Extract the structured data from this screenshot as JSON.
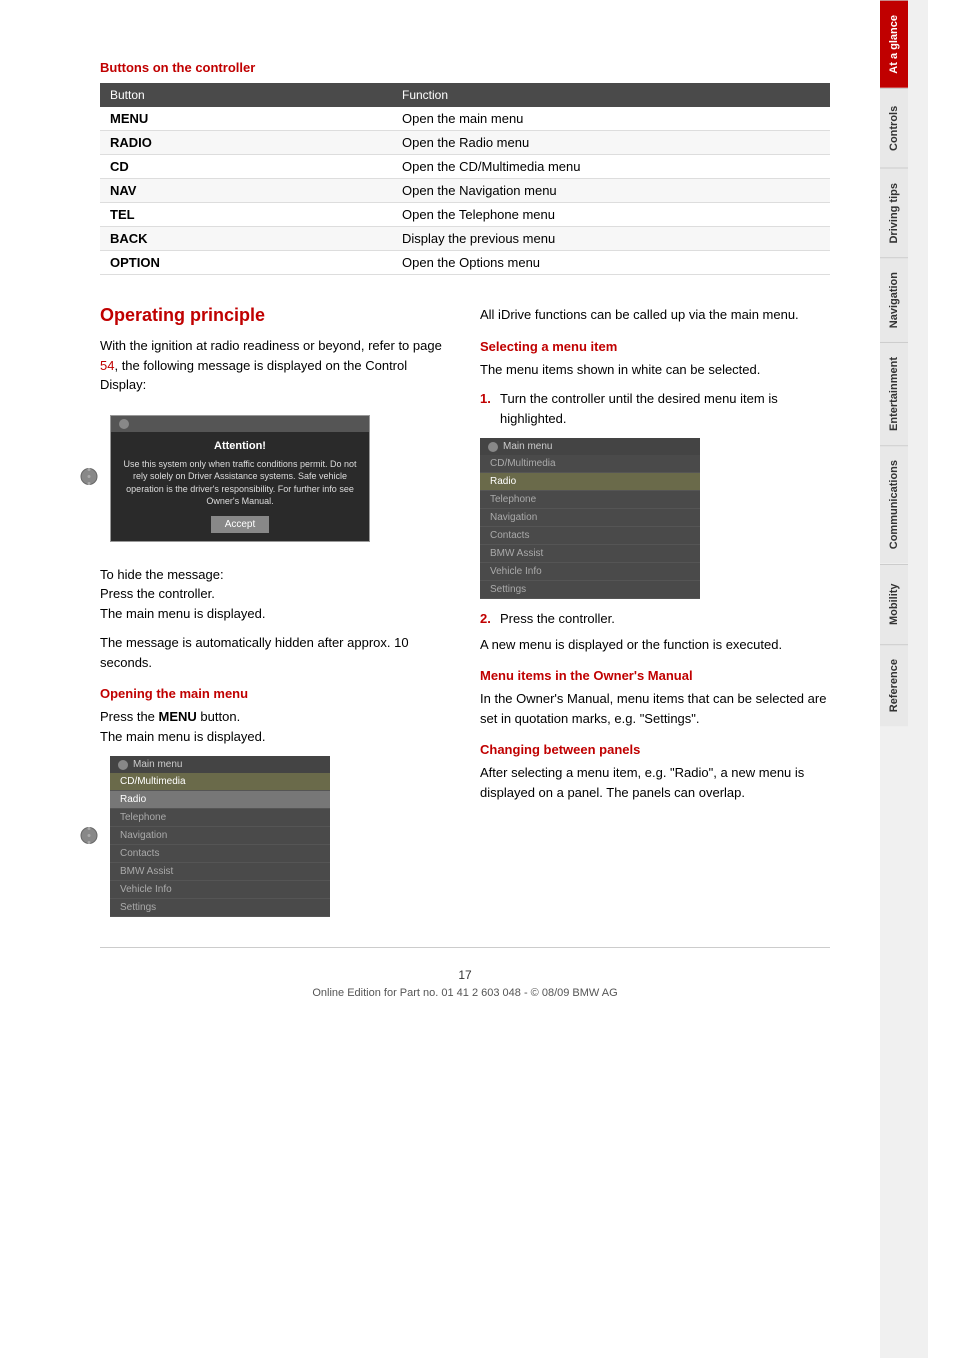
{
  "page": {
    "number": "17",
    "footer_text": "Online Edition for Part no. 01 41 2 603 048 - © 08/09 BMW AG"
  },
  "sidebar": {
    "tabs": [
      {
        "id": "at-a-glance",
        "label": "At a glance",
        "active": true
      },
      {
        "id": "controls",
        "label": "Controls",
        "active": false
      },
      {
        "id": "driving-tips",
        "label": "Driving tips",
        "active": false
      },
      {
        "id": "navigation",
        "label": "Navigation",
        "active": false
      },
      {
        "id": "entertainment",
        "label": "Entertainment",
        "active": false
      },
      {
        "id": "communications",
        "label": "Communications",
        "active": false
      },
      {
        "id": "mobility",
        "label": "Mobility",
        "active": false
      },
      {
        "id": "reference",
        "label": "Reference",
        "active": false
      }
    ]
  },
  "buttons_table": {
    "section_heading": "Buttons on the controller",
    "col_button": "Button",
    "col_function": "Function",
    "rows": [
      {
        "button": "MENU",
        "function": "Open the main menu"
      },
      {
        "button": "RADIO",
        "function": "Open the Radio menu"
      },
      {
        "button": "CD",
        "function": "Open the CD/Multimedia menu"
      },
      {
        "button": "NAV",
        "function": "Open the Navigation menu"
      },
      {
        "button": "TEL",
        "function": "Open the Telephone menu"
      },
      {
        "button": "BACK",
        "function": "Display the previous menu"
      },
      {
        "button": "OPTION",
        "function": "Open the Options menu"
      }
    ]
  },
  "operating_principle": {
    "title": "Operating principle",
    "intro": "With the ignition at radio readiness or beyond, refer to page ",
    "page_ref": "54",
    "intro_cont": ", the following message is displayed on the Control Display:",
    "attention_title": "Attention!",
    "attention_body": "Use this system only when traffic conditions permit. Do not rely solely on Driver Assistance systems. Safe vehicle operation is the driver's responsibility. For further info see Owner's Manual.",
    "accept_button": "Accept",
    "to_hide_label": "To hide the message:",
    "press_controller": "Press the controller.",
    "main_menu_displayed": "The main menu is displayed.",
    "auto_hidden": "The message is automatically hidden after approx. 10 seconds.",
    "opening_main_menu_heading": "Opening the main menu",
    "press_menu": "Press the ",
    "menu_bold": "MENU",
    "button_label": " button.",
    "main_menu_displayed2": "The main menu is displayed.",
    "menu_screen_title": "Main menu",
    "menu_items_left": [
      {
        "label": "CD/Multimedia",
        "style": "highlighted"
      },
      {
        "label": "Radio",
        "style": "selected"
      },
      {
        "label": "Telephone",
        "style": "normal"
      },
      {
        "label": "Navigation",
        "style": "normal"
      },
      {
        "label": "Contacts",
        "style": "normal"
      },
      {
        "label": "BMW Assist",
        "style": "normal"
      },
      {
        "label": "Vehicle Info",
        "style": "normal"
      },
      {
        "label": "Settings",
        "style": "normal"
      }
    ]
  },
  "right_column": {
    "all_idrive": "All iDrive functions can be called up via the main menu.",
    "selecting_heading": "Selecting a menu item",
    "selecting_body": "The menu items shown in white can be selected.",
    "step1_label": "1.",
    "step1_text": "Turn the controller until the desired menu item is highlighted.",
    "menu_screen_title_right": "Main menu",
    "menu_items_right": [
      {
        "label": "CD/Multimedia",
        "style": "normal"
      },
      {
        "label": "Radio",
        "style": "highlighted"
      },
      {
        "label": "Telephone",
        "style": "normal"
      },
      {
        "label": "Navigation",
        "style": "normal"
      },
      {
        "label": "Contacts",
        "style": "normal"
      },
      {
        "label": "BMW Assist",
        "style": "normal"
      },
      {
        "label": "Vehicle Info",
        "style": "normal"
      },
      {
        "label": "Settings",
        "style": "normal"
      }
    ],
    "step2_label": "2.",
    "step2_text": "Press the controller.",
    "new_menu_displayed": "A new menu is displayed or the function is executed.",
    "menu_items_owners_heading": "Menu items in the Owner's Manual",
    "menu_items_owners_body": "In the Owner's Manual, menu items that can be selected are set in quotation marks, e.g. \"Settings\".",
    "changing_panels_heading": "Changing between panels",
    "changing_panels_body": "After selecting a menu item, e.g. \"Radio\", a new menu is displayed on a panel. The panels can overlap."
  }
}
